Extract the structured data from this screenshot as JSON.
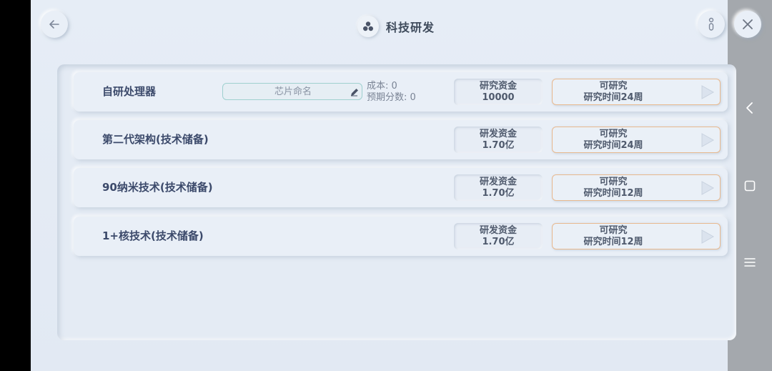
{
  "header": {
    "title": "科技研发",
    "back_icon": "arrow-left-icon",
    "info_icon": "info-icon",
    "close_icon": "close-icon",
    "title_icon": "atom-icon"
  },
  "system_nav": {
    "back_icon": "chevron-left-icon",
    "home_icon": "square-icon",
    "menu_icon": "hamburger-menu-icon"
  },
  "rows": [
    {
      "name": "自研处理器",
      "input_placeholder": "芯片命名",
      "cost": "成本: 0",
      "score": "预期分数: 0",
      "fund_label": "研究资金",
      "fund_value": "10000",
      "status": "可研究",
      "time": "研究时间24周"
    },
    {
      "name": "第二代架构(技术储备)",
      "fund_label": "研发资金",
      "fund_value": "1.70亿",
      "status": "可研究",
      "time": "研究时间24周"
    },
    {
      "name": "90纳米技术(技术储备)",
      "fund_label": "研发资金",
      "fund_value": "1.70亿",
      "status": "可研究",
      "time": "研究时间12周"
    },
    {
      "name": "1+核技术(技术储备)",
      "fund_label": "研发资金",
      "fund_value": "1.70亿",
      "status": "可研究",
      "time": "研究时间12周"
    }
  ],
  "colors": {
    "background": "#e4ebf4",
    "accent_orange": "#e8b98f",
    "accent_teal": "#9fd0cf",
    "text_dark": "#3c4a6b"
  }
}
